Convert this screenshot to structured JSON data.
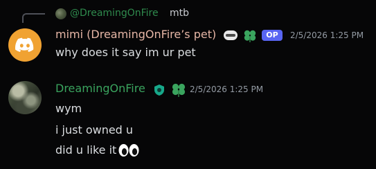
{
  "reply": {
    "author": "@DreamingOnFire",
    "text": "mtb"
  },
  "messages": [
    {
      "author": "mimi (DreamingOnFire’s pet)",
      "author_color": "#e6b6a6",
      "badge_op": "OP",
      "timestamp": "2/5/2026 1:25 PM",
      "lines": [
        "why does it say im ur pet"
      ],
      "avatar": "discord-logo-icon"
    },
    {
      "author": "DreamingOnFire",
      "author_color": "#3aa45e",
      "timestamp": "2/5/2026 1:25 PM",
      "lines": [
        "wym",
        "i just owned u",
        "did u like it"
      ],
      "avatar": "profile-photo"
    }
  ],
  "colors": {
    "background": "#060607",
    "op_badge": "#5865f2",
    "discord_avatar": "#f0a232",
    "mention": "#2f8a4d"
  }
}
